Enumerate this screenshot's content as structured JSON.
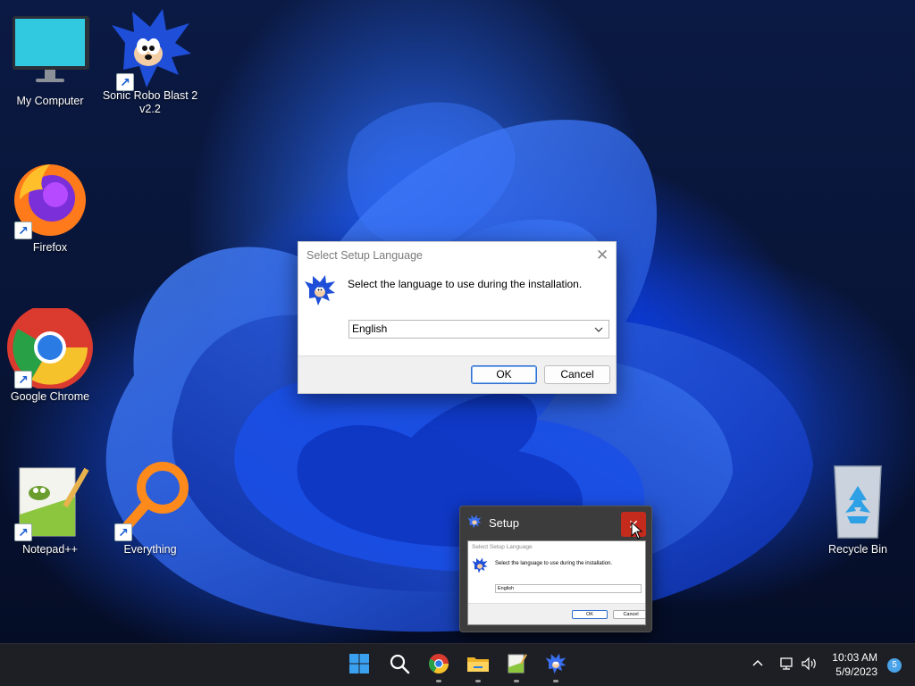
{
  "desktop": {
    "icons": [
      {
        "label": "My Computer"
      },
      {
        "label": "Sonic Robo Blast 2 v2.2"
      },
      {
        "label": "Firefox"
      },
      {
        "label": "Google Chrome"
      },
      {
        "label": "Notepad++"
      },
      {
        "label": "Everything"
      },
      {
        "label": "Recycle Bin"
      }
    ]
  },
  "dialog": {
    "title": "Select Setup Language",
    "close_glyph": "✕",
    "prompt": "Select the language to use during the installation.",
    "language_value": "English",
    "ok_label": "OK",
    "cancel_label": "Cancel"
  },
  "preview": {
    "title": "Setup",
    "close_glyph": "✕"
  },
  "taskbar": {
    "apps": [
      "start-icon",
      "search-icon",
      "chrome-icon",
      "file-explorer-icon",
      "notepadpp-icon",
      "sonic-setup-icon"
    ]
  },
  "tray": {
    "time": "10:03 AM",
    "date": "5/9/2023",
    "notification_count": "5"
  },
  "colors": {
    "taskbar_bg": "#1e1f24",
    "close_red": "#c42b1c",
    "ok_border": "#2f6fd0"
  }
}
